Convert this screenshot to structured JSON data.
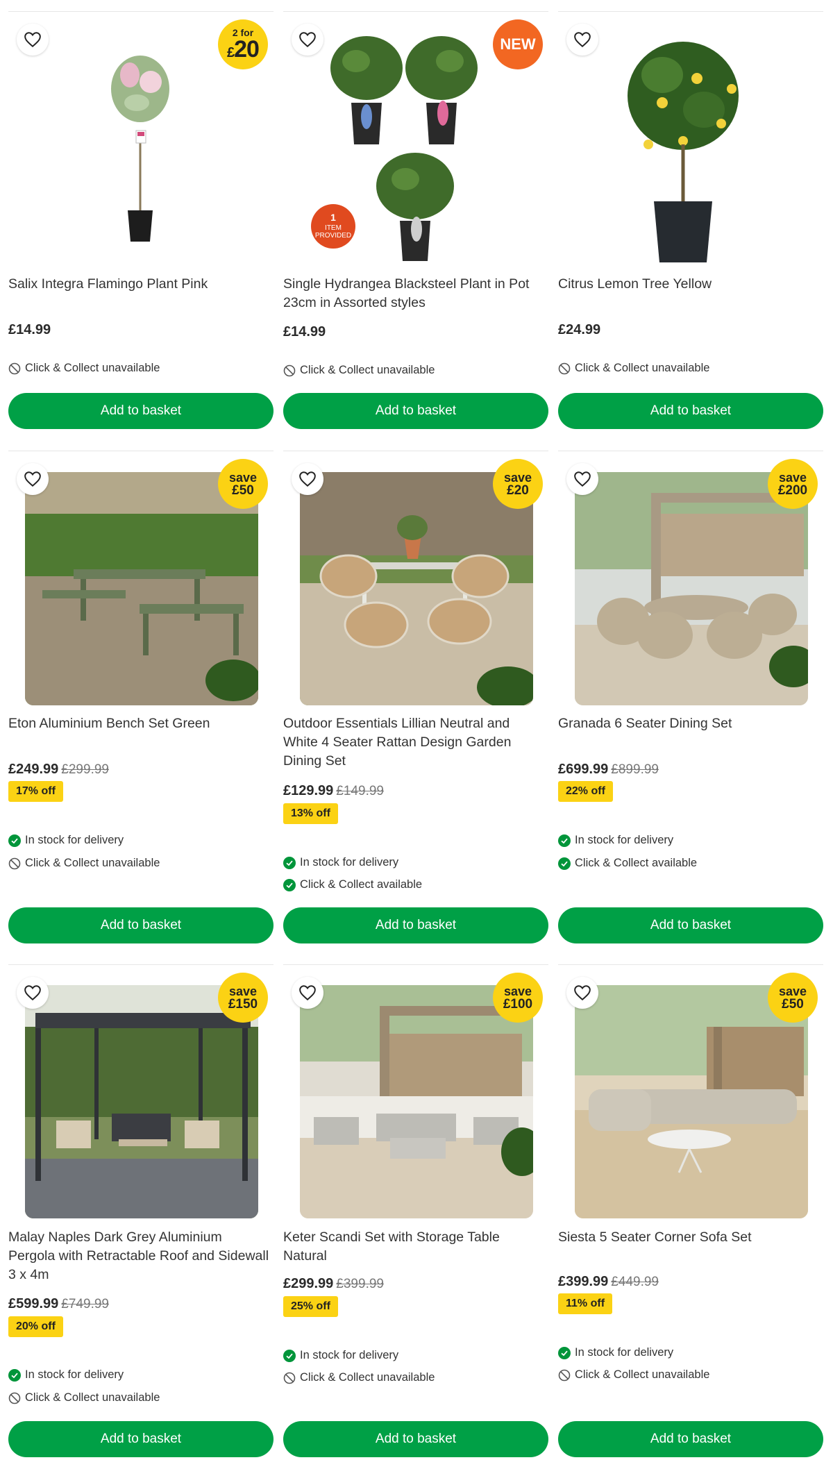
{
  "products": [
    {
      "title": "Salix Integra Flamingo Plant Pink",
      "price": "£14.99",
      "was": "",
      "off": "",
      "badge": {
        "type": "2for",
        "line1": "2 for",
        "symbol": "£",
        "amount": "20"
      },
      "status": [
        {
          "ok": false,
          "text": "Click & Collect unavailable"
        }
      ],
      "button": "Add to basket"
    },
    {
      "title": "Single Hydrangea Blacksteel Plant in Pot 23cm in Assorted styles",
      "price": "£14.99",
      "was": "",
      "off": "",
      "badge": {
        "type": "new",
        "line1": "NEW"
      },
      "sticker": {
        "num": "1",
        "line1": "ITEM",
        "line2": "PROVIDED"
      },
      "status": [
        {
          "ok": false,
          "text": "Click & Collect unavailable"
        }
      ],
      "button": "Add to basket"
    },
    {
      "title": "Citrus Lemon Tree Yellow",
      "price": "£24.99",
      "was": "",
      "off": "",
      "badge": {
        "type": "none"
      },
      "status": [
        {
          "ok": false,
          "text": "Click & Collect unavailable"
        }
      ],
      "button": "Add to basket"
    },
    {
      "title": "Eton Aluminium Bench Set Green",
      "price": "£249.99",
      "was": "£299.99",
      "off": "17% off",
      "badge": {
        "type": "save",
        "line1": "save",
        "line2": "£50"
      },
      "status": [
        {
          "ok": true,
          "text": "In stock for delivery"
        },
        {
          "ok": false,
          "text": "Click & Collect unavailable"
        }
      ],
      "button": "Add to basket"
    },
    {
      "title": "Outdoor Essentials Lillian Neutral and White 4 Seater Rattan Design Garden Dining Set",
      "price": "£129.99",
      "was": "£149.99",
      "off": "13% off",
      "badge": {
        "type": "save",
        "line1": "save",
        "line2": "£20"
      },
      "status": [
        {
          "ok": true,
          "text": "In stock for delivery"
        },
        {
          "ok": true,
          "text": "Click & Collect available"
        }
      ],
      "button": "Add to basket"
    },
    {
      "title": "Granada 6 Seater Dining Set",
      "price": "£699.99",
      "was": "£899.99",
      "off": "22% off",
      "badge": {
        "type": "save",
        "line1": "save",
        "line2": "£200"
      },
      "status": [
        {
          "ok": true,
          "text": "In stock for delivery"
        },
        {
          "ok": true,
          "text": "Click & Collect available"
        }
      ],
      "button": "Add to basket"
    },
    {
      "title": "Malay Naples Dark Grey Aluminium Pergola with Retractable Roof and Sidewall 3 x 4m",
      "price": "£599.99",
      "was": "£749.99",
      "off": "20% off",
      "badge": {
        "type": "save",
        "line1": "save",
        "line2": "£150"
      },
      "status": [
        {
          "ok": true,
          "text": "In stock for delivery"
        },
        {
          "ok": false,
          "text": "Click & Collect unavailable"
        }
      ],
      "button": "Add to basket"
    },
    {
      "title": "Keter Scandi Set with Storage Table Natural",
      "price": "£299.99",
      "was": "£399.99",
      "off": "25% off",
      "badge": {
        "type": "save",
        "line1": "save",
        "line2": "£100"
      },
      "status": [
        {
          "ok": true,
          "text": "In stock for delivery"
        },
        {
          "ok": false,
          "text": "Click & Collect unavailable"
        }
      ],
      "button": "Add to basket"
    },
    {
      "title": "Siesta 5 Seater Corner Sofa Set",
      "price": "£399.99",
      "was": "£449.99",
      "off": "11% off",
      "badge": {
        "type": "save",
        "line1": "save",
        "line2": "£50"
      },
      "status": [
        {
          "ok": true,
          "text": "In stock for delivery"
        },
        {
          "ok": false,
          "text": "Click & Collect unavailable"
        }
      ],
      "button": "Add to basket"
    }
  ],
  "colors": {
    "accent_green": "#00a046",
    "badge_yellow": "#fbd214",
    "new_orange": "#f26722"
  },
  "icons": {
    "favourite": "heart-outline-icon",
    "ok": "check-circle-icon",
    "unavailable": "no-entry-icon"
  }
}
